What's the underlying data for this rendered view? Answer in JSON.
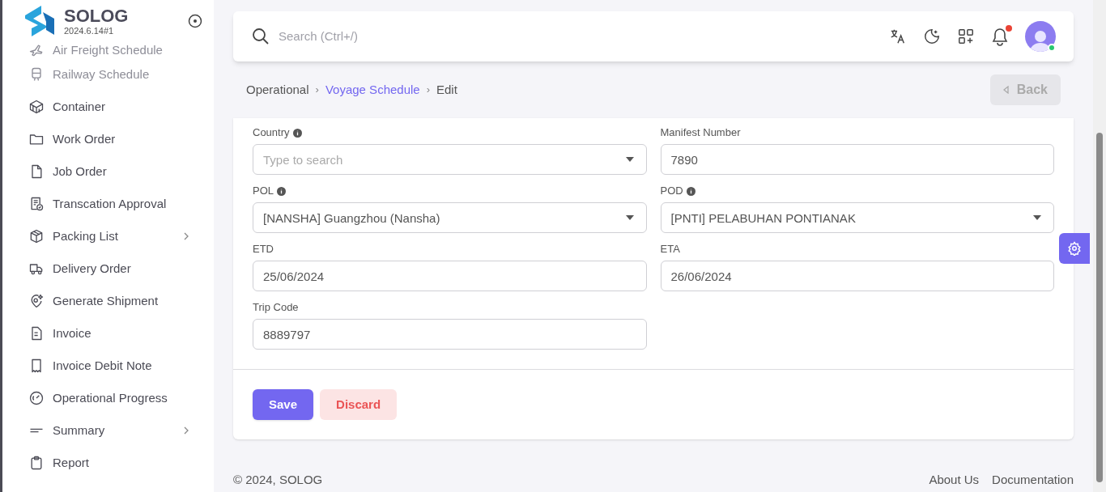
{
  "brand": {
    "name": "SOLOG",
    "version": "2024.6.14#1"
  },
  "sidebar": {
    "items": [
      {
        "label": "Air Freight Schedule",
        "dimmed": true,
        "has_submenu": false
      },
      {
        "label": "Railway Schedule",
        "dimmed": true,
        "has_submenu": false
      },
      {
        "label": "Container",
        "dimmed": false,
        "has_submenu": false
      },
      {
        "label": "Work Order",
        "dimmed": false,
        "has_submenu": false
      },
      {
        "label": "Job Order",
        "dimmed": false,
        "has_submenu": false
      },
      {
        "label": "Transcation Approval",
        "dimmed": false,
        "has_submenu": false
      },
      {
        "label": "Packing List",
        "dimmed": false,
        "has_submenu": true
      },
      {
        "label": "Delivery Order",
        "dimmed": false,
        "has_submenu": false
      },
      {
        "label": "Generate Shipment",
        "dimmed": false,
        "has_submenu": false
      },
      {
        "label": "Invoice",
        "dimmed": false,
        "has_submenu": false
      },
      {
        "label": "Invoice Debit Note",
        "dimmed": false,
        "has_submenu": false
      },
      {
        "label": "Operational Progress",
        "dimmed": false,
        "has_submenu": false
      },
      {
        "label": "Summary",
        "dimmed": false,
        "has_submenu": true
      },
      {
        "label": "Report",
        "dimmed": false,
        "has_submenu": false
      }
    ]
  },
  "header": {
    "search_placeholder": "Search (Ctrl+/)",
    "notification_unread": true,
    "user_online": true
  },
  "breadcrumb": [
    {
      "kind": "crumb",
      "label": "Operational",
      "link": false
    },
    {
      "kind": "separator",
      "label": "›"
    },
    {
      "kind": "crumb",
      "label": "Voyage Schedule",
      "link": true
    },
    {
      "kind": "separator",
      "label": "›"
    },
    {
      "kind": "crumb",
      "label": "Edit",
      "link": false
    }
  ],
  "back_button": {
    "label": "Back",
    "disabled": true
  },
  "form": {
    "fields": [
      {
        "label": "Country",
        "info": true,
        "kind": "select",
        "placeholder": "Type to search"
      },
      {
        "label": "Manifest Number",
        "info": false,
        "kind": "text",
        "value": "7890"
      },
      {
        "label": "POL",
        "info": true,
        "kind": "select",
        "value": "[NANSHA] Guangzhou (Nansha)"
      },
      {
        "label": "POD",
        "info": true,
        "kind": "select",
        "value": "[PNTI] PELABUHAN PONTIANAK"
      },
      {
        "label": "ETD",
        "info": false,
        "kind": "text",
        "value": "25/06/2024"
      },
      {
        "label": "ETA",
        "info": false,
        "kind": "text",
        "value": "26/06/2024"
      },
      {
        "label": "Trip Code",
        "info": false,
        "kind": "text",
        "value": "8889797"
      }
    ],
    "buttons": [
      {
        "label": "Save",
        "kind": "primary"
      },
      {
        "label": "Discard",
        "kind": "danger"
      }
    ]
  },
  "footer": {
    "copyright": "© 2024, SOLOG",
    "links": [
      "About Us",
      "Documentation"
    ]
  }
}
